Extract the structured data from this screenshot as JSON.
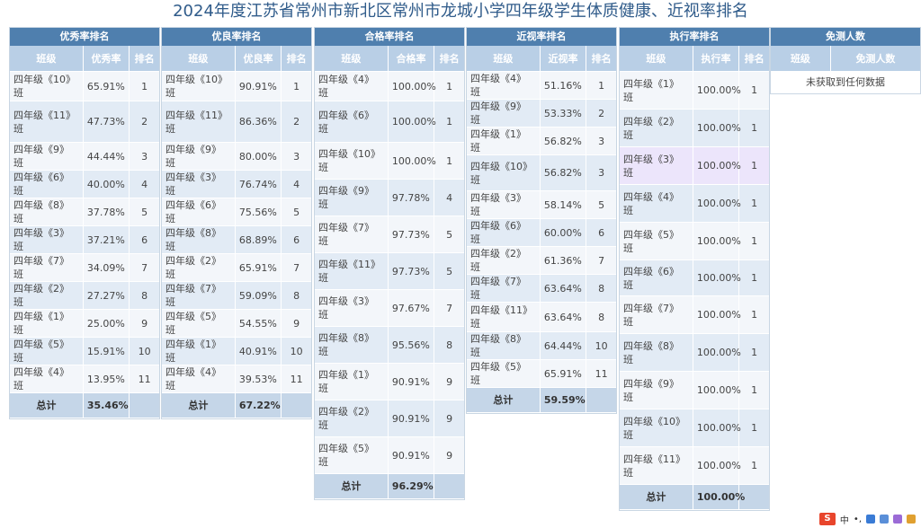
{
  "title": "2024年度江苏省常州市新北区常州市龙城小学四年级学生体质健康、近视率排名",
  "panels": [
    {
      "id": "excellent",
      "header": "优秀率排名",
      "columns": [
        "班级",
        "优秀率",
        "排名"
      ],
      "rows": [
        {
          "cls": "四年级《10》班",
          "rate": "65.91%",
          "rank": "1"
        },
        {
          "cls": "四年级《11》班",
          "rate": "47.73%",
          "rank": "2"
        },
        {
          "cls": "四年级《9》班",
          "rate": "44.44%",
          "rank": "3"
        },
        {
          "cls": "四年级《6》班",
          "rate": "40.00%",
          "rank": "4"
        },
        {
          "cls": "四年级《8》班",
          "rate": "37.78%",
          "rank": "5"
        },
        {
          "cls": "四年级《3》班",
          "rate": "37.21%",
          "rank": "6"
        },
        {
          "cls": "四年级《7》班",
          "rate": "34.09%",
          "rank": "7"
        },
        {
          "cls": "四年级《2》班",
          "rate": "27.27%",
          "rank": "8"
        },
        {
          "cls": "四年级《1》班",
          "rate": "25.00%",
          "rank": "9"
        },
        {
          "cls": "四年级《5》班",
          "rate": "15.91%",
          "rank": "10"
        },
        {
          "cls": "四年级《4》班",
          "rate": "13.95%",
          "rank": "11"
        }
      ],
      "total": {
        "label": "总计",
        "value": "35.46%"
      }
    },
    {
      "id": "good",
      "header": "优良率排名",
      "columns": [
        "班级",
        "优良率",
        "排名"
      ],
      "rows": [
        {
          "cls": "四年级《10》班",
          "rate": "90.91%",
          "rank": "1"
        },
        {
          "cls": "四年级《11》班",
          "rate": "86.36%",
          "rank": "2"
        },
        {
          "cls": "四年级《9》班",
          "rate": "80.00%",
          "rank": "3"
        },
        {
          "cls": "四年级《3》班",
          "rate": "76.74%",
          "rank": "4"
        },
        {
          "cls": "四年级《6》班",
          "rate": "75.56%",
          "rank": "5"
        },
        {
          "cls": "四年级《8》班",
          "rate": "68.89%",
          "rank": "6"
        },
        {
          "cls": "四年级《2》班",
          "rate": "65.91%",
          "rank": "7"
        },
        {
          "cls": "四年级《7》班",
          "rate": "59.09%",
          "rank": "8"
        },
        {
          "cls": "四年级《5》班",
          "rate": "54.55%",
          "rank": "9"
        },
        {
          "cls": "四年级《1》班",
          "rate": "40.91%",
          "rank": "10"
        },
        {
          "cls": "四年级《4》班",
          "rate": "39.53%",
          "rank": "11"
        }
      ],
      "total": {
        "label": "总计",
        "value": "67.22%"
      }
    },
    {
      "id": "pass",
      "header": "合格率排名",
      "columns": [
        "班级",
        "合格率",
        "排名"
      ],
      "rows": [
        {
          "cls": "四年级《4》班",
          "rate": "100.00%",
          "rank": "1"
        },
        {
          "cls": "四年级《6》班",
          "rate": "100.00%",
          "rank": "1"
        },
        {
          "cls": "四年级《10》班",
          "rate": "100.00%",
          "rank": "1"
        },
        {
          "cls": "四年级《9》班",
          "rate": "97.78%",
          "rank": "4"
        },
        {
          "cls": "四年级《7》班",
          "rate": "97.73%",
          "rank": "5"
        },
        {
          "cls": "四年级《11》班",
          "rate": "97.73%",
          "rank": "5"
        },
        {
          "cls": "四年级《3》班",
          "rate": "97.67%",
          "rank": "7"
        },
        {
          "cls": "四年级《8》班",
          "rate": "95.56%",
          "rank": "8"
        },
        {
          "cls": "四年级《1》班",
          "rate": "90.91%",
          "rank": "9"
        },
        {
          "cls": "四年级《2》班",
          "rate": "90.91%",
          "rank": "9"
        },
        {
          "cls": "四年级《5》班",
          "rate": "90.91%",
          "rank": "9"
        }
      ],
      "total": {
        "label": "总计",
        "value": "96.29%"
      }
    },
    {
      "id": "myopia",
      "header": "近视率排名",
      "columns": [
        "班级",
        "近视率",
        "排名"
      ],
      "rows": [
        {
          "cls": "四年级《4》班",
          "rate": "51.16%",
          "rank": "1"
        },
        {
          "cls": "四年级《9》班",
          "rate": "53.33%",
          "rank": "2"
        },
        {
          "cls": "四年级《1》班",
          "rate": "56.82%",
          "rank": "3"
        },
        {
          "cls": "四年级《10》班",
          "rate": "56.82%",
          "rank": "3"
        },
        {
          "cls": "四年级《3》班",
          "rate": "58.14%",
          "rank": "5"
        },
        {
          "cls": "四年级《6》班",
          "rate": "60.00%",
          "rank": "6"
        },
        {
          "cls": "四年级《2》班",
          "rate": "61.36%",
          "rank": "7"
        },
        {
          "cls": "四年级《7》班",
          "rate": "63.64%",
          "rank": "8"
        },
        {
          "cls": "四年级《11》班",
          "rate": "63.64%",
          "rank": "8"
        },
        {
          "cls": "四年级《8》班",
          "rate": "64.44%",
          "rank": "10"
        },
        {
          "cls": "四年级《5》班",
          "rate": "65.91%",
          "rank": "11"
        }
      ],
      "total": {
        "label": "总计",
        "value": "59.59%"
      }
    },
    {
      "id": "execution",
      "header": "执行率排名",
      "columns": [
        "班级",
        "执行率",
        "排名"
      ],
      "rows": [
        {
          "cls": "四年级《1》班",
          "rate": "100.00%",
          "rank": "1"
        },
        {
          "cls": "四年级《2》班",
          "rate": "100.00%",
          "rank": "1"
        },
        {
          "cls": "四年级《3》班",
          "rate": "100.00%",
          "rank": "1"
        },
        {
          "cls": "四年级《4》班",
          "rate": "100.00%",
          "rank": "1"
        },
        {
          "cls": "四年级《5》班",
          "rate": "100.00%",
          "rank": "1"
        },
        {
          "cls": "四年级《6》班",
          "rate": "100.00%",
          "rank": "1"
        },
        {
          "cls": "四年级《7》班",
          "rate": "100.00%",
          "rank": "1"
        },
        {
          "cls": "四年级《8》班",
          "rate": "100.00%",
          "rank": "1"
        },
        {
          "cls": "四年级《9》班",
          "rate": "100.00%",
          "rank": "1"
        },
        {
          "cls": "四年级《10》班",
          "rate": "100.00%",
          "rank": "1"
        },
        {
          "cls": "四年级《11》班",
          "rate": "100.00%",
          "rank": "1"
        }
      ],
      "total": {
        "label": "总计",
        "value": "100.00%"
      }
    }
  ],
  "exempt": {
    "header": "免测人数",
    "columns": [
      "班级",
      "免测人数"
    ],
    "empty_message": "未获取到任何数据"
  },
  "taskbar": {
    "ime_logo": "S",
    "ime_lang": "中",
    "ime_punct": "•,"
  },
  "colors": {
    "panel_header": "#4f7fae",
    "column_header": "#b9cfe6",
    "row_light": "#f3f6fa",
    "row_dark": "#e2ebf5",
    "highlight_row": "#ece5fb",
    "total_row": "#c5d6e8",
    "title": "#2f5b8a"
  }
}
